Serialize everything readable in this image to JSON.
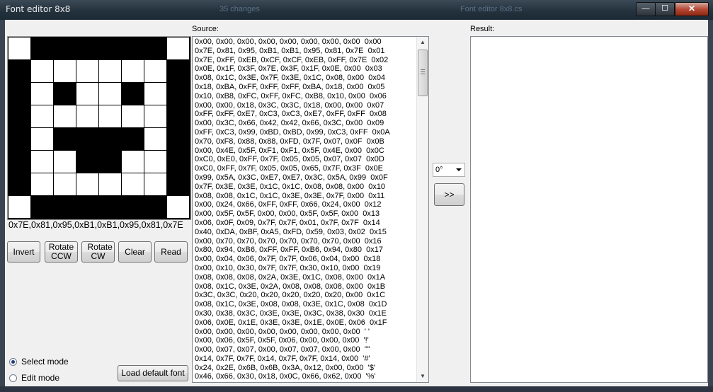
{
  "window": {
    "title": "Font editor 8x8",
    "bg_text_1": "35 changes",
    "bg_text_2": "Font editor 8x8.cs"
  },
  "titlebar_buttons": {
    "minimize": "—",
    "maximize": "☐",
    "close": "✕"
  },
  "grid": [
    [
      0,
      1,
      1,
      1,
      1,
      1,
      1,
      0
    ],
    [
      1,
      0,
      0,
      0,
      0,
      0,
      0,
      1
    ],
    [
      1,
      0,
      1,
      0,
      0,
      1,
      0,
      1
    ],
    [
      1,
      0,
      0,
      0,
      0,
      0,
      0,
      1
    ],
    [
      1,
      0,
      1,
      1,
      1,
      1,
      0,
      1
    ],
    [
      1,
      0,
      0,
      1,
      1,
      0,
      0,
      1
    ],
    [
      1,
      0,
      0,
      0,
      0,
      0,
      0,
      1
    ],
    [
      0,
      1,
      1,
      1,
      1,
      1,
      1,
      0
    ]
  ],
  "grid_hex": "0x7E,0x81,0x95,0xB1,0xB1,0x95,0x81,0x7E",
  "buttons": {
    "invert": "Invert",
    "rotate_ccw": "Rotate CCW",
    "rotate_cw": "Rotate CW",
    "clear": "Clear",
    "read": "Read",
    "load_default": "Load default font",
    "convert": ">>"
  },
  "modes": {
    "select": "Select mode",
    "edit": "Edit mode",
    "selected": "select"
  },
  "source": {
    "label": "Source:",
    "lines": [
      "0x00, 0x00, 0x00, 0x00, 0x00, 0x00, 0x00, 0x00  0x00",
      "0x7E, 0x81, 0x95, 0xB1, 0xB1, 0x95, 0x81, 0x7E  0x01",
      "0x7E, 0xFF, 0xEB, 0xCF, 0xCF, 0xEB, 0xFF, 0x7E  0x02",
      "0x0E, 0x1F, 0x3F, 0x7E, 0x3F, 0x1F, 0x0E, 0x00  0x03",
      "0x08, 0x1C, 0x3E, 0x7F, 0x3E, 0x1C, 0x08, 0x00  0x04",
      "0x18, 0xBA, 0xFF, 0xFF, 0xFF, 0xBA, 0x18, 0x00  0x05",
      "0x10, 0xB8, 0xFC, 0xFF, 0xFC, 0xB8, 0x10, 0x00  0x06",
      "0x00, 0x00, 0x18, 0x3C, 0x3C, 0x18, 0x00, 0x00  0x07",
      "0xFF, 0xFF, 0xE7, 0xC3, 0xC3, 0xE7, 0xFF, 0xFF  0x08",
      "0x00, 0x3C, 0x66, 0x42, 0x42, 0x66, 0x3C, 0x00  0x09",
      "0xFF, 0xC3, 0x99, 0xBD, 0xBD, 0x99, 0xC3, 0xFF  0x0A",
      "0x70, 0xF8, 0x88, 0x88, 0xFD, 0x7F, 0x07, 0x0F  0x0B",
      "0x00, 0x4E, 0x5F, 0xF1, 0xF1, 0x5F, 0x4E, 0x00  0x0C",
      "0xC0, 0xE0, 0xFF, 0x7F, 0x05, 0x05, 0x07, 0x07  0x0D",
      "0xC0, 0xFF, 0x7F, 0x05, 0x05, 0x65, 0x7F, 0x3F  0x0E",
      "0x99, 0x5A, 0x3C, 0xE7, 0xE7, 0x3C, 0x5A, 0x99  0x0F",
      "0x7F, 0x3E, 0x3E, 0x1C, 0x1C, 0x08, 0x08, 0x00  0x10",
      "0x08, 0x08, 0x1C, 0x1C, 0x3E, 0x3E, 0x7F, 0x00  0x11",
      "0x00, 0x24, 0x66, 0xFF, 0xFF, 0x66, 0x24, 0x00  0x12",
      "0x00, 0x5F, 0x5F, 0x00, 0x00, 0x5F, 0x5F, 0x00  0x13",
      "0x06, 0x0F, 0x09, 0x7F, 0x7F, 0x01, 0x7F, 0x7F  0x14",
      "0x40, 0xDA, 0xBF, 0xA5, 0xFD, 0x59, 0x03, 0x02  0x15",
      "0x00, 0x70, 0x70, 0x70, 0x70, 0x70, 0x70, 0x00  0x16",
      "0x80, 0x94, 0xB6, 0xFF, 0xFF, 0xB6, 0x94, 0x80  0x17",
      "0x00, 0x04, 0x06, 0x7F, 0x7F, 0x06, 0x04, 0x00  0x18",
      "0x00, 0x10, 0x30, 0x7F, 0x7F, 0x30, 0x10, 0x00  0x19",
      "0x08, 0x08, 0x08, 0x2A, 0x3E, 0x1C, 0x08, 0x00  0x1A",
      "0x08, 0x1C, 0x3E, 0x2A, 0x08, 0x08, 0x08, 0x00  0x1B",
      "0x3C, 0x3C, 0x20, 0x20, 0x20, 0x20, 0x20, 0x00  0x1C",
      "0x08, 0x1C, 0x3E, 0x08, 0x08, 0x3E, 0x1C, 0x08  0x1D",
      "0x30, 0x38, 0x3C, 0x3E, 0x3E, 0x3C, 0x38, 0x30  0x1E",
      "0x06, 0x0E, 0x1E, 0x3E, 0x3E, 0x1E, 0x0E, 0x06  0x1F",
      "0x00, 0x00, 0x00, 0x00, 0x00, 0x00, 0x00, 0x00  ' '",
      "0x00, 0x06, 0x5F, 0x5F, 0x06, 0x00, 0x00, 0x00  '!'",
      "0x00, 0x07, 0x07, 0x00, 0x07, 0x07, 0x00, 0x00  '\"'",
      "0x14, 0x7F, 0x7F, 0x14, 0x7F, 0x7F, 0x14, 0x00  '#'",
      "0x24, 0x2E, 0x6B, 0x6B, 0x3A, 0x12, 0x00, 0x00  '$'",
      "0x46, 0x66, 0x30, 0x18, 0x0C, 0x66, 0x62, 0x00  '%'"
    ]
  },
  "rotation": {
    "value": "0°"
  },
  "result": {
    "label": "Result:",
    "text": ""
  }
}
